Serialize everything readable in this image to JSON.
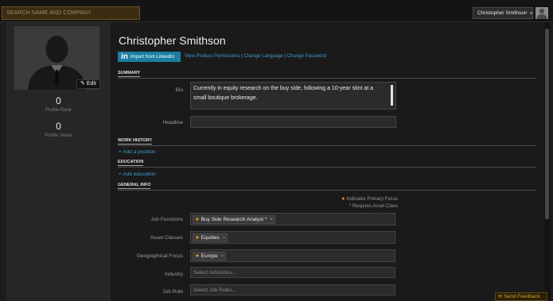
{
  "header": {
    "search_placeholder": "SEARCH NAME AND COMPANY",
    "user_name": "Christopher Smithson",
    "caret": "▾"
  },
  "sidebar": {
    "edit_label": "Edit",
    "edit_icon": "pencil-icon",
    "profile_rank_value": "0",
    "profile_rank_label": "Profile Rank",
    "profile_views_value": "0",
    "profile_views_label": "Profile Views"
  },
  "profile": {
    "name": "Christopher Smithson",
    "linkedin_in": "in",
    "linkedin_label": "Import from LinkedIn",
    "links": {
      "permissions": "View Product Permissions",
      "language": "Change Language",
      "password": "Change Password",
      "separator": "|"
    }
  },
  "summary": {
    "heading": "SUMMARY",
    "bio_label": "Bio",
    "bio_text": "Currently in equity research on the buy side, following a 10-year stint at a small boutique brokerage.",
    "headline_label": "Headline",
    "headline_value": ""
  },
  "work_history": {
    "heading": "WORK HISTORY",
    "add_label": "+ Add a position"
  },
  "education": {
    "heading": "EDUCATION",
    "add_label": "+ Add education"
  },
  "general_info": {
    "heading": "GENERAL INFO",
    "legend_primary": "Indicates Primary Focus",
    "legend_required": "* Requires Asset Class",
    "job_functions_label": "Job Functions",
    "job_functions_chip": "Buy Side Research Analyst *",
    "asset_classes_label": "Asset Classes",
    "asset_classes_chip": "Equities",
    "geo_focus_label": "Geographical Focus",
    "geo_focus_chip": "Europe",
    "industry_label": "Industry",
    "industry_placeholder": "Select Industries...",
    "job_role_label": "Job Role",
    "job_role_placeholder": "Select Job Roles...",
    "star_glyph": "★",
    "remove_glyph": "×"
  },
  "feedback": {
    "label": "Send Feedback",
    "icon": "envelope-icon"
  },
  "colors": {
    "accent_orange": "#f0a228",
    "link_blue": "#3d9bd1",
    "linkedin_blue": "#1b7ea2",
    "background": "#1a1a1a"
  }
}
